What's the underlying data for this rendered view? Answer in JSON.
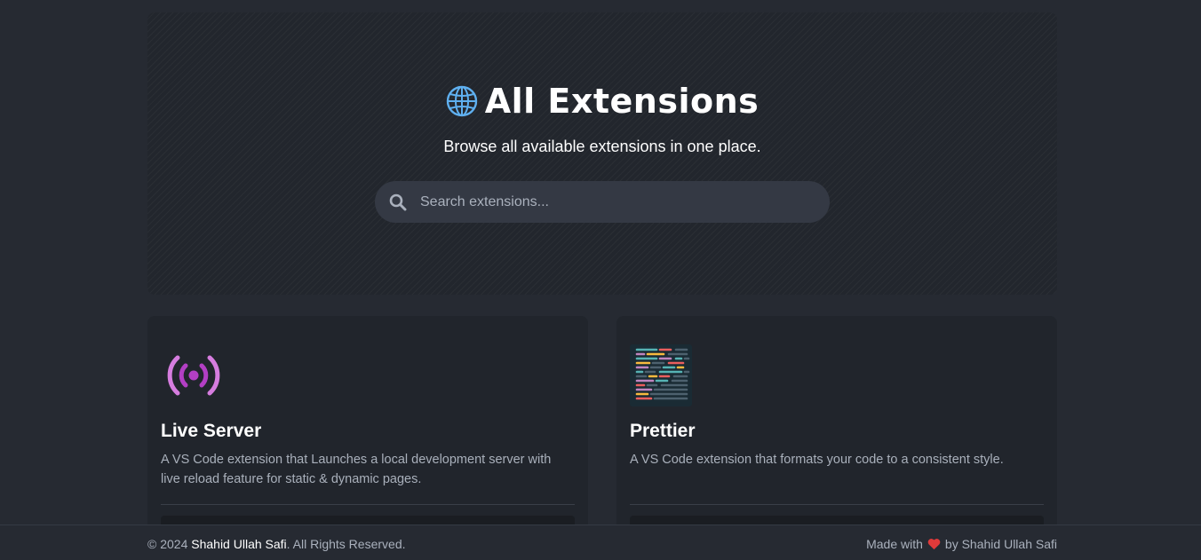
{
  "hero": {
    "title": "All Extensions",
    "subtitle": "Browse all available extensions in one place.",
    "search": {
      "placeholder": "Search extensions...",
      "value": ""
    },
    "icon": "globe-icon"
  },
  "cards": [
    {
      "title": "Live Server",
      "description": "A VS Code extension that Launches a local development server with live reload feature for static & dynamic pages.",
      "icon": "broadcast-icon",
      "accent": "#b33fc4"
    },
    {
      "title": "Prettier",
      "description": "A VS Code extension that formats your code to a consistent style.",
      "icon": "prettier-logo",
      "accent": "#1a2b34"
    }
  ],
  "footer": {
    "copyright_prefix": "© 2024",
    "author": "Shahid Ullah Safi",
    "rights": ". All Rights Reserved.",
    "made_with": "Made with",
    "by": "by Shahid Ullah Safi",
    "heart_color": "#e03a3a"
  },
  "colors": {
    "background": "#262a32",
    "card": "#21252c",
    "search": "#343944"
  }
}
